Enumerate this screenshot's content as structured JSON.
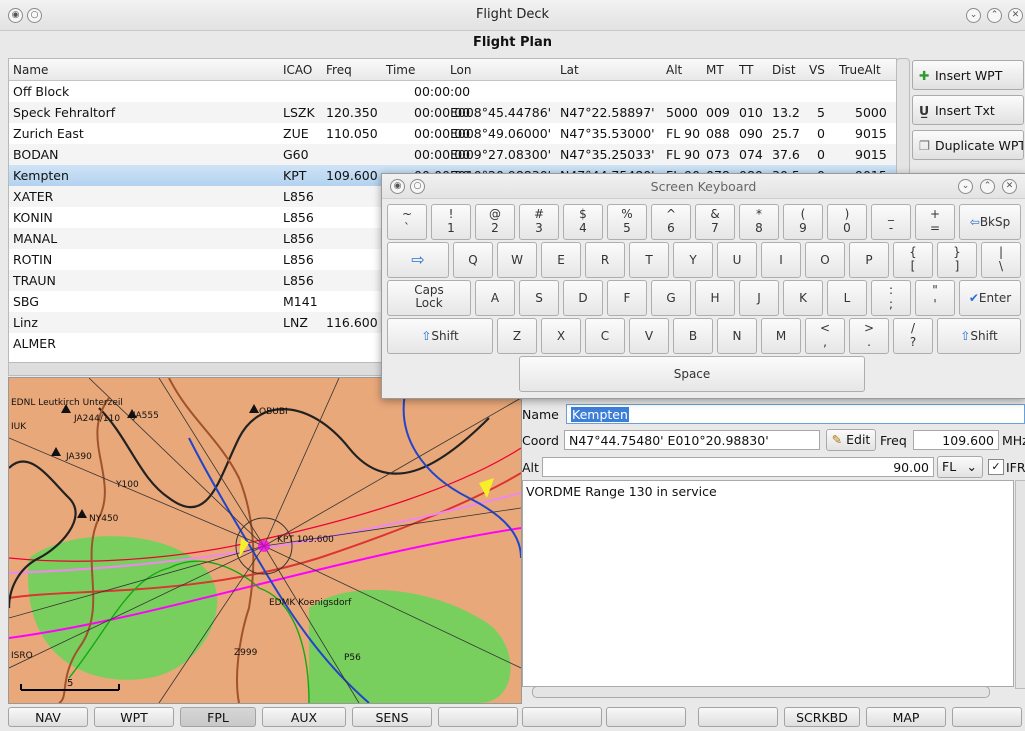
{
  "window": {
    "title": "Flight Deck"
  },
  "flight_plan": {
    "title": "Flight Plan",
    "columns": [
      "Name",
      "ICAO",
      "Freq",
      "Time",
      "Lon",
      "Lat",
      "Alt",
      "MT",
      "TT",
      "Dist",
      "VS",
      "TrueAlt"
    ],
    "rows": [
      {
        "name": "Off Block",
        "icao": "",
        "freq": "",
        "time": "00:00:00",
        "lon": "",
        "lat": "",
        "alt": "",
        "mt": "",
        "tt": "",
        "dist": "",
        "vs": "",
        "truealt": ""
      },
      {
        "name": "Speck Fehraltorf",
        "icao": "LSZK",
        "freq": "120.350",
        "time": "00:00:00",
        "lon": "E008°45.44786'",
        "lat": "N47°22.58897'",
        "alt": "5000",
        "mt": "009",
        "tt": "010",
        "dist": "13.2",
        "vs": "5",
        "truealt": "5000"
      },
      {
        "name": "Zurich East",
        "icao": "ZUE",
        "freq": "110.050",
        "time": "00:00:00",
        "lon": "E008°49.06000'",
        "lat": "N47°35.53000'",
        "alt": "FL 90",
        "mt": "088",
        "tt": "090",
        "dist": "25.7",
        "vs": "0",
        "truealt": "9015"
      },
      {
        "name": "BODAN",
        "icao": "G60",
        "freq": "",
        "time": "00:00:00",
        "lon": "E009°27.08300'",
        "lat": "N47°35.25033'",
        "alt": "FL 90",
        "mt": "073",
        "tt": "074",
        "dist": "37.6",
        "vs": "0",
        "truealt": "9015"
      },
      {
        "name": "Kempten",
        "icao": "KPT",
        "freq": "109.600",
        "time": "00:00:00",
        "lon": "E010°20.98830'",
        "lat": "N47°44.75480'",
        "alt": "FL 90",
        "mt": "078",
        "tt": "080",
        "dist": "30.5",
        "vs": "0",
        "truealt": "9015"
      },
      {
        "name": "XATER",
        "icao": "L856"
      },
      {
        "name": "KONIN",
        "icao": "L856"
      },
      {
        "name": "MANAL",
        "icao": "L856"
      },
      {
        "name": "ROTIN",
        "icao": "L856"
      },
      {
        "name": "TRAUN",
        "icao": "L856"
      },
      {
        "name": "SBG",
        "icao": "M141"
      },
      {
        "name": "Linz",
        "icao": "LNZ",
        "freq": "116.600"
      },
      {
        "name": "ALMER",
        "icao": ""
      }
    ]
  },
  "side_buttons": [
    {
      "label": "Insert WPT",
      "icon": "plus-icon"
    },
    {
      "label": "Insert Txt",
      "icon": "text-icon"
    },
    {
      "label": "Duplicate WPT",
      "icon": "duplicate-icon"
    }
  ],
  "keyboard": {
    "title": "Screen Keyboard",
    "row1": [
      [
        "~",
        "`"
      ],
      [
        "!",
        "1"
      ],
      [
        "@",
        "2"
      ],
      [
        "#",
        "3"
      ],
      [
        "$",
        "4"
      ],
      [
        "%",
        "5"
      ],
      [
        "^",
        "6"
      ],
      [
        "&",
        "7"
      ],
      [
        "*",
        "8"
      ],
      [
        "(",
        "9"
      ],
      [
        ")",
        "0"
      ],
      [
        "_",
        "-"
      ],
      [
        "+",
        "="
      ]
    ],
    "backspace": "BkSp",
    "row2": [
      "Q",
      "W",
      "E",
      "R",
      "T",
      "Y",
      "U",
      "I",
      "O",
      "P"
    ],
    "row2_extra": [
      [
        "{",
        "["
      ],
      [
        "}",
        "]"
      ],
      [
        "|",
        "\\"
      ]
    ],
    "caps": "Caps Lock",
    "row3": [
      "A",
      "S",
      "D",
      "F",
      "G",
      "H",
      "J",
      "K",
      "L"
    ],
    "row3_extra": [
      [
        ":",
        ";"
      ],
      [
        "\"",
        "'"
      ]
    ],
    "enter": "Enter",
    "shift": "Shift",
    "row4": [
      "Z",
      "X",
      "C",
      "V",
      "B",
      "N",
      "M"
    ],
    "row4_extra": [
      [
        "<",
        ","
      ],
      [
        ">",
        "."
      ],
      [
        "/",
        "?"
      ]
    ],
    "space": "Space"
  },
  "map": {
    "labels": [
      "EDNL Leutkirch Unterzeil",
      "JA555",
      "JA244/110",
      "OBUBI",
      "IUK",
      "JA390",
      "Y100",
      "NY450",
      "KPT 109.600",
      "EDMK Koenigsdorf",
      "Z999",
      "ISRO",
      "5",
      "P56"
    ]
  },
  "waypoint": {
    "name_label": "Name",
    "name_value": "Kempten",
    "coord_label": "Coord",
    "coord_value": "N47°44.75480' E010°20.98830'",
    "edit_label": "Edit",
    "freq_label": "Freq",
    "freq_value": "109.600",
    "freq_unit": "MHz",
    "alt_label": "Alt",
    "alt_value": "90.00",
    "alt_unit": "FL",
    "ifr_label": "IFR",
    "notes": "VORDME Range 130 in service"
  },
  "tabs": [
    "NAV",
    "WPT",
    "FPL",
    "AUX",
    "SENS",
    "",
    "",
    "",
    "",
    "SCRKBD",
    "MAP",
    ""
  ],
  "active_tab": "FPL"
}
